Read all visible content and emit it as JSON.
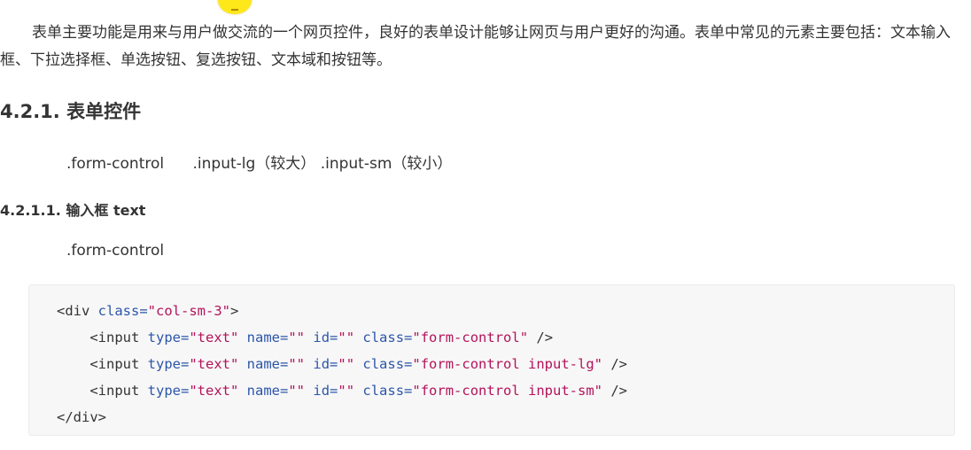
{
  "intro": {
    "text": "表单主要功能是用来与用户做交流的一个网页控件，良好的表单设计能够让网页与用户更好的沟通。表单中常见的元素主要包括：文本输入框、下拉选择框、单选按钮、复选按钮、文本域和按钮等。"
  },
  "section": {
    "heading": "4.2.1. 表单控件",
    "classes_text": ".form-control      .input-lg（较大） .input-sm（较小）"
  },
  "subsection": {
    "heading": "4.2.1.1. 输入框 text",
    "class_text": ".form-control"
  },
  "code": {
    "lines": [
      [
        {
          "t": "tag",
          "v": "<div "
        },
        {
          "t": "attr",
          "v": "class="
        },
        {
          "t": "str",
          "v": "\"col-sm-3\""
        },
        {
          "t": "tag",
          "v": ">"
        }
      ],
      [
        {
          "t": "tag",
          "v": "    <input "
        },
        {
          "t": "attr",
          "v": "type="
        },
        {
          "t": "str",
          "v": "\"text\""
        },
        {
          "t": "tag",
          "v": " "
        },
        {
          "t": "attr",
          "v": "name="
        },
        {
          "t": "str",
          "v": "\"\""
        },
        {
          "t": "tag",
          "v": " "
        },
        {
          "t": "attr",
          "v": "id="
        },
        {
          "t": "str",
          "v": "\"\""
        },
        {
          "t": "tag",
          "v": " "
        },
        {
          "t": "attr",
          "v": "class="
        },
        {
          "t": "str",
          "v": "\"form-control\""
        },
        {
          "t": "tag",
          "v": " />"
        }
      ],
      [
        {
          "t": "tag",
          "v": "    <input "
        },
        {
          "t": "attr",
          "v": "type="
        },
        {
          "t": "str",
          "v": "\"text\""
        },
        {
          "t": "tag",
          "v": " "
        },
        {
          "t": "attr",
          "v": "name="
        },
        {
          "t": "str",
          "v": "\"\""
        },
        {
          "t": "tag",
          "v": " "
        },
        {
          "t": "attr",
          "v": "id="
        },
        {
          "t": "str",
          "v": "\"\""
        },
        {
          "t": "tag",
          "v": " "
        },
        {
          "t": "attr",
          "v": "class="
        },
        {
          "t": "str",
          "v": "\"form-control input-lg\""
        },
        {
          "t": "tag",
          "v": " />"
        }
      ],
      [
        {
          "t": "tag",
          "v": "    <input "
        },
        {
          "t": "attr",
          "v": "type="
        },
        {
          "t": "str",
          "v": "\"text\""
        },
        {
          "t": "tag",
          "v": " "
        },
        {
          "t": "attr",
          "v": "name="
        },
        {
          "t": "str",
          "v": "\"\""
        },
        {
          "t": "tag",
          "v": " "
        },
        {
          "t": "attr",
          "v": "id="
        },
        {
          "t": "str",
          "v": "\"\""
        },
        {
          "t": "tag",
          "v": " "
        },
        {
          "t": "attr",
          "v": "class="
        },
        {
          "t": "str",
          "v": "\"form-control input-sm\""
        },
        {
          "t": "tag",
          "v": " />"
        }
      ],
      [
        {
          "t": "tag",
          "v": "</div>"
        }
      ]
    ]
  },
  "colors": {
    "text": "#333333",
    "code_background": "#f7f7f7",
    "code_attr": "#2c56a8",
    "code_string": "#b3135b",
    "cursor_highlight": "#ffe81a"
  }
}
